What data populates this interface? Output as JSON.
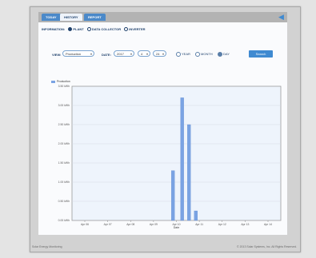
{
  "tabs": [
    {
      "label": "TODAY"
    },
    {
      "label": "HISTORY"
    },
    {
      "label": "REPORT"
    }
  ],
  "back_icon": "back-arrow-icon",
  "breadcrumb": {
    "label": "INFORMATION:",
    "options": [
      "PLANT",
      "DATA COLLECTOR",
      "INVERTER"
    ]
  },
  "filter": {
    "view_label": "VIEW:",
    "view_value": "Production",
    "date_label": "DATE:",
    "year_value": "2017",
    "month_value": "4",
    "day_value": "24",
    "radios": [
      "YEAR",
      "MONTH",
      "DAY"
    ],
    "search_label": "Search"
  },
  "legend": {
    "label": "Production"
  },
  "chart_data": {
    "type": "bar",
    "title": "",
    "xlabel": "Date",
    "ylabel": "",
    "y_tick_labels": [
      "0.00 kWh",
      "0.50 kWh",
      "1.00 kWh",
      "1.50 kWh",
      "2.00 kWh",
      "2.50 kWh",
      "3.00 kWh",
      "3.50 kWh"
    ],
    "ylim": [
      0,
      3.5
    ],
    "x_tick_labels": [
      "Apr 06",
      "Apr 07",
      "Apr 08",
      "Apr 09",
      "Apr 10",
      "Apr 11",
      "Apr 12",
      "Apr 13",
      "Apr 14"
    ],
    "categories": [
      "Apr 10",
      "Apr 10",
      "Apr 11",
      "Apr 11",
      "Apr 11"
    ],
    "x": [
      9.85,
      10.25,
      10.55,
      10.85,
      11.15
    ],
    "values": [
      1.3,
      3.2,
      2.5,
      0.25,
      0.0
    ],
    "color": "#7aa3e3",
    "grid": true
  },
  "footer": {
    "left": "Solar Energy Monitoring",
    "right": "© 2013 Solar Systems, Inc. All Rights Reserved."
  }
}
